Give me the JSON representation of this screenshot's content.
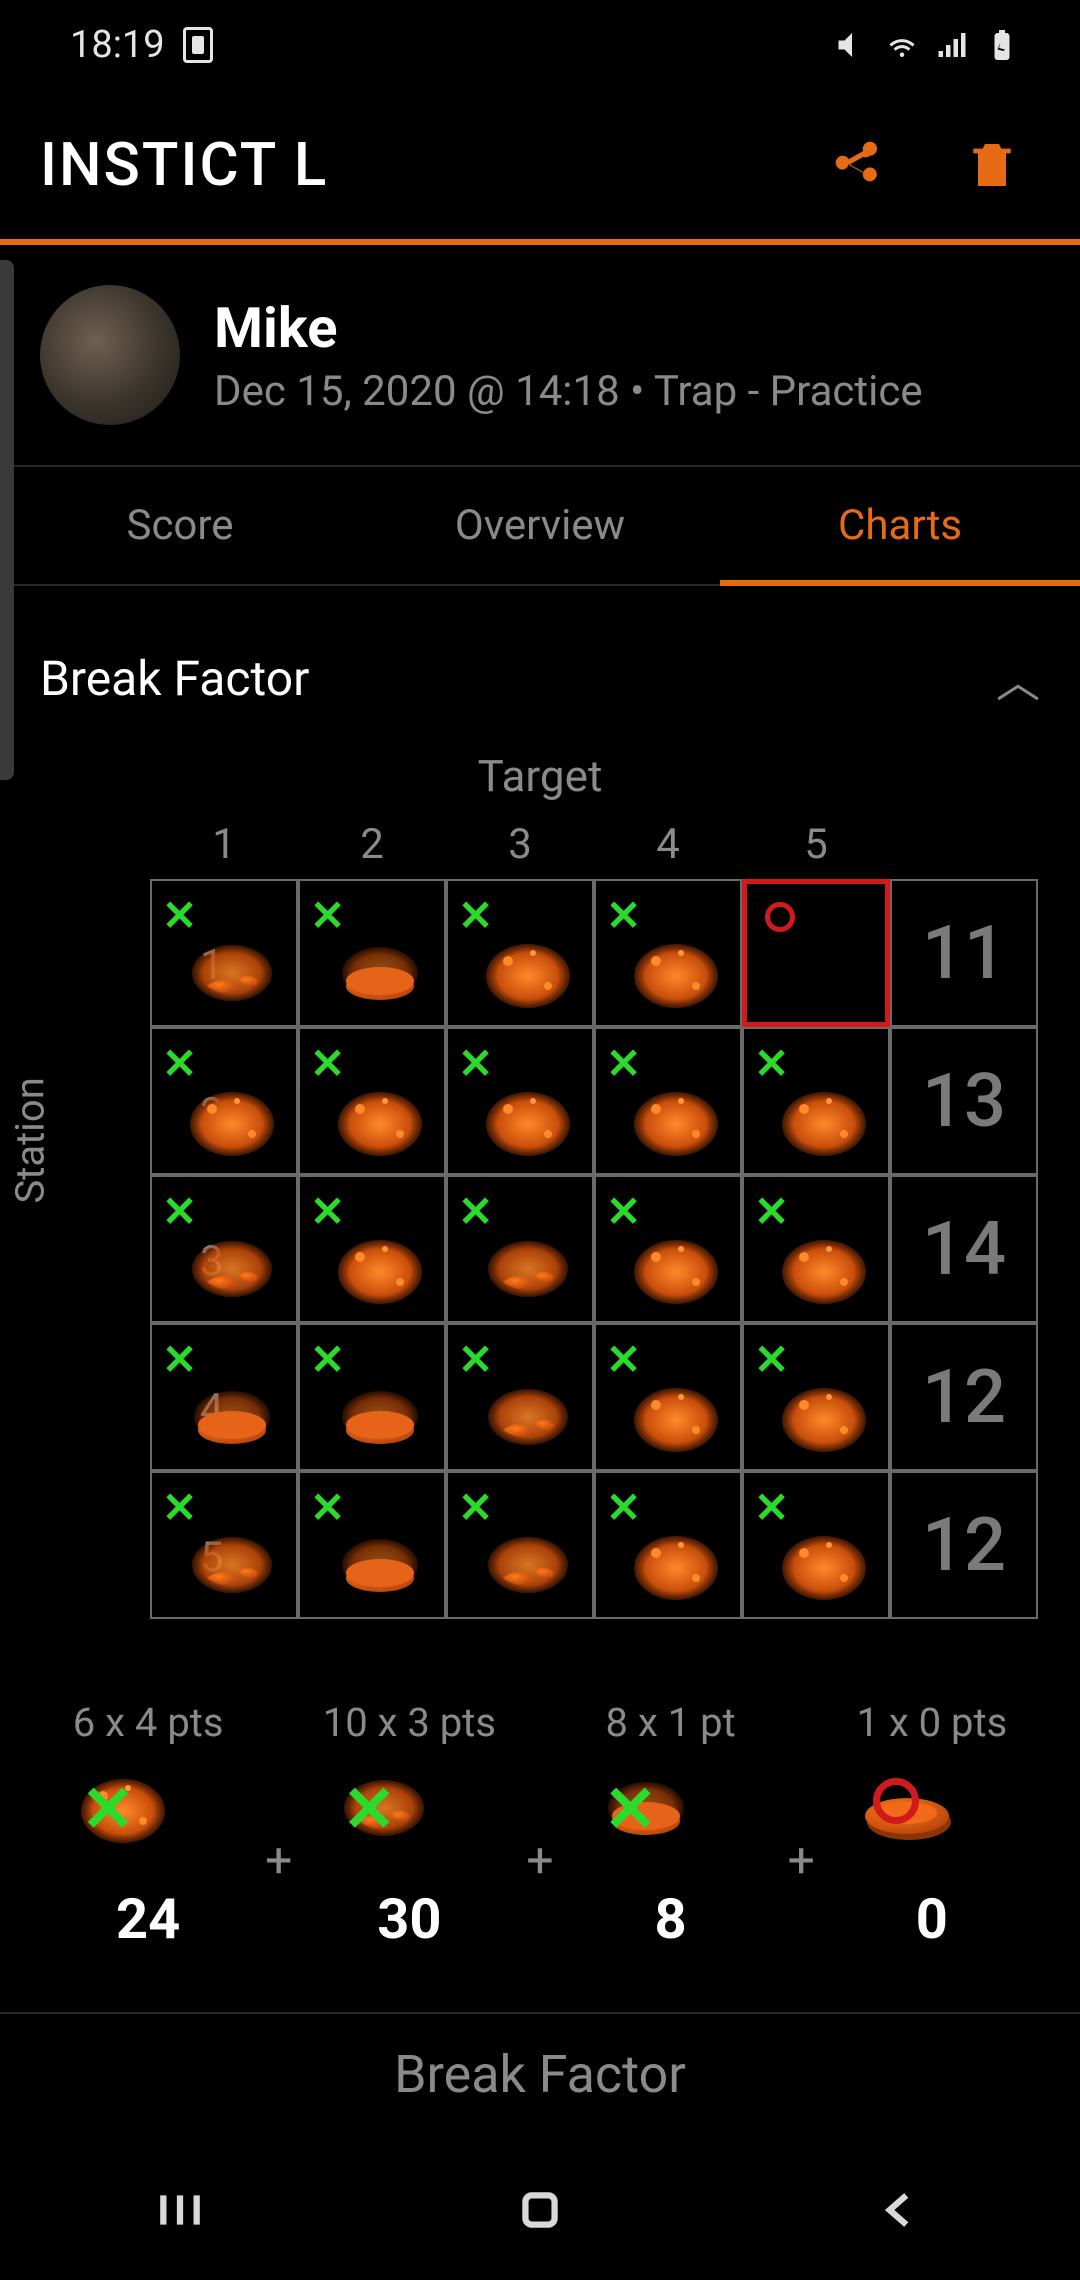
{
  "status": {
    "time": "18:19"
  },
  "app": {
    "title": "INSTICT L"
  },
  "user": {
    "name": "Mike",
    "subtitle": "Dec 15, 2020 @ 14:18 • Trap - Practice"
  },
  "tabs": [
    {
      "label": "Score",
      "active": false
    },
    {
      "label": "Overview",
      "active": false
    },
    {
      "label": "Charts",
      "active": true
    }
  ],
  "section": {
    "title": "Break Factor"
  },
  "axes": {
    "top": "Target",
    "left": "Station"
  },
  "columns": [
    "1",
    "2",
    "3",
    "4",
    "5",
    ""
  ],
  "rowLabels": [
    "1",
    "2",
    "3",
    "4",
    "5"
  ],
  "chart_data": {
    "type": "table",
    "title": "Break Factor",
    "xlabel": "Target",
    "ylabel": "Station",
    "columns": [
      "1",
      "2",
      "3",
      "4",
      "5",
      "Row total"
    ],
    "rows": [
      "1",
      "2",
      "3",
      "4",
      "5"
    ],
    "hits": [
      [
        true,
        true,
        true,
        true,
        false
      ],
      [
        true,
        true,
        true,
        true,
        true
      ],
      [
        true,
        true,
        true,
        true,
        true
      ],
      [
        true,
        true,
        true,
        true,
        true
      ],
      [
        true,
        true,
        true,
        true,
        true
      ]
    ],
    "row_totals": [
      11,
      13,
      14,
      12,
      12
    ],
    "break_variants": [
      [
        "chunks",
        "disc",
        "dust",
        "dust",
        "miss"
      ],
      [
        "dust",
        "dust",
        "dust",
        "dust",
        "dust"
      ],
      [
        "chunks",
        "dust",
        "chunks",
        "dust",
        "dust"
      ],
      [
        "disc",
        "disc",
        "chunks",
        "dust",
        "dust"
      ],
      [
        "chunks",
        "disc",
        "chunks",
        "dust",
        "dust"
      ]
    ]
  },
  "summary": [
    {
      "label": "6 x 4 pts",
      "variant": "dust",
      "mark": "hit",
      "value": "24"
    },
    {
      "label": "10 x 3 pts",
      "variant": "chunks",
      "mark": "hit",
      "value": "30"
    },
    {
      "label": "8 x 1 pt",
      "variant": "disc",
      "mark": "hit",
      "value": "8"
    },
    {
      "label": "1 x 0 pts",
      "variant": "whole",
      "mark": "miss",
      "value": "0"
    }
  ],
  "bottom": {
    "label": "Break Factor"
  }
}
